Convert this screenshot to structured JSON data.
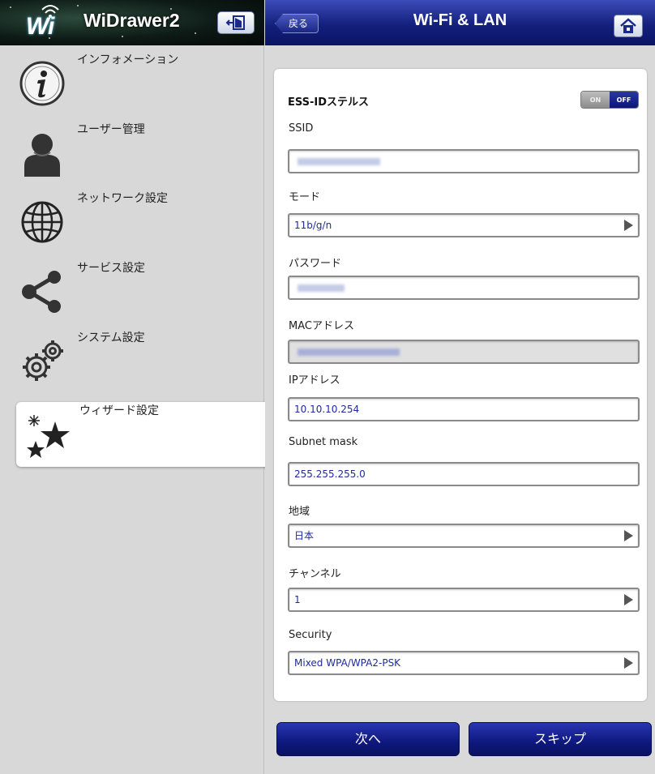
{
  "sidebar": {
    "app_title": "WiDrawer2",
    "logo_text": "Wi",
    "items": [
      {
        "label": "インフォメーション"
      },
      {
        "label": "ユーザー管理"
      },
      {
        "label": "ネットワーク設定"
      },
      {
        "label": "サービス設定"
      },
      {
        "label": "システム設定"
      },
      {
        "label": "ウィザード設定",
        "active": true
      }
    ]
  },
  "header": {
    "back_label": "戻る",
    "title": "Wi-Fi & LAN"
  },
  "form": {
    "stealth": {
      "label": "ESS-IDステルス",
      "on_label": "ON",
      "off_label": "OFF",
      "value": "OFF"
    },
    "ssid": {
      "label": "SSID"
    },
    "mode": {
      "label": "モード",
      "value": "11b/g/n"
    },
    "password": {
      "label": "パスワード"
    },
    "mac": {
      "label": "MACアドレス"
    },
    "ip": {
      "label": "IPアドレス",
      "value": "10.10.10.254"
    },
    "subnet": {
      "label": "Subnet mask",
      "value": "255.255.255.0"
    },
    "region": {
      "label": "地域",
      "value": "日本"
    },
    "channel": {
      "label": "チャンネル",
      "value": "1"
    },
    "security": {
      "label": "Security",
      "value": "Mixed WPA/WPA2-PSK"
    }
  },
  "footer": {
    "next_label": "次へ",
    "skip_label": "スキップ"
  },
  "colors": {
    "header_blue": "#14207c",
    "button_blue": "#0e187e",
    "field_text": "#1e2aa0"
  }
}
